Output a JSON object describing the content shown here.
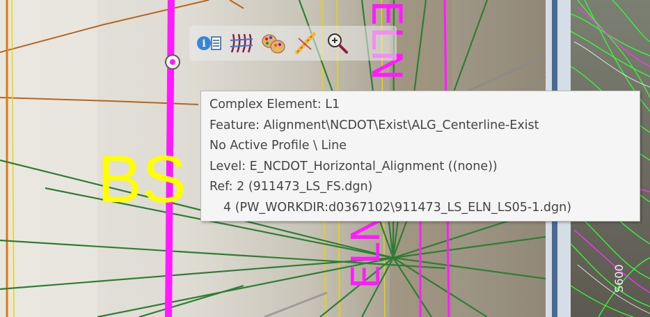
{
  "toolbar": {
    "buttons": [
      {
        "icon": "element-info-icon"
      },
      {
        "icon": "properties-icon"
      },
      {
        "icon": "color-palette-icon"
      },
      {
        "icon": "civil-tools-icon"
      },
      {
        "icon": "zoom-icon"
      }
    ]
  },
  "canvas_labels": {
    "bs_text": "BS",
    "vertical_text": "ELN",
    "contour_text": "S600"
  },
  "tooltip": {
    "element": "Complex Element: L1",
    "feature": "Feature: Alignment\\NCDOT\\Exist\\ALG_Centerline-Exist",
    "profile": "No Active Profile \\ Line",
    "level": "Level: E_NCDOT_Horizontal_Alignment ((none))",
    "ref1": "Ref: 2 (911473_LS_FS.dgn)",
    "ref2": "4 (PW_WORKDIR:d0367102\\911473_LS_ELN_LS05-1.dgn)"
  },
  "colors": {
    "alignment_magenta": "#ff1aff",
    "text_yellow": "#ffff00",
    "line_green": "#2e7d32",
    "line_brown": "#b5651d",
    "contour_green": "#33ff33"
  }
}
